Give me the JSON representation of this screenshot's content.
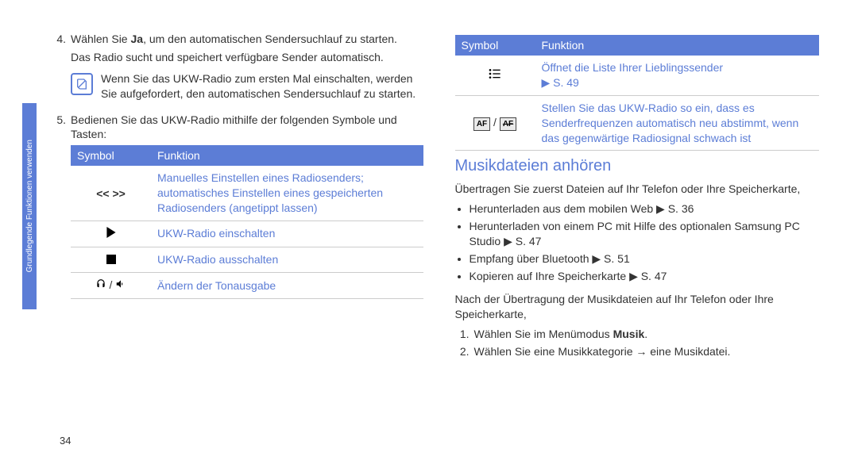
{
  "sidebar_label": "Grundlegende Funktionen verwenden",
  "page_number": "34",
  "left": {
    "step4_num": "4.",
    "step4_a": "Wählen Sie ",
    "step4_bold": "Ja",
    "step4_b": ", um den automatischen Sendersuchlauf zu starten.",
    "step4_sub": "Das Radio sucht und speichert verfügbare Sender automatisch.",
    "note": "Wenn Sie das UKW-Radio zum ersten Mal einschalten, werden Sie aufgefordert, den automatischen Sendersuchlauf zu starten.",
    "step5_num": "5.",
    "step5": "Bedienen Sie das UKW-Radio mithilfe der folgenden Symbole und Tasten:",
    "table": {
      "h1": "Symbol",
      "h2": "Funktion",
      "rows": [
        {
          "sym": "<<  >>",
          "func": "Manuelles Einstellen eines Radiosenders; automatisches Einstellen eines gespeicherten Radiosenders (angetippt lassen)"
        },
        {
          "sym": "play",
          "func": "UKW-Radio einschalten"
        },
        {
          "sym": "stop",
          "func": "UKW-Radio ausschalten"
        },
        {
          "sym": "audio",
          "func": "Ändern der Tonausgabe"
        }
      ]
    }
  },
  "right": {
    "table": {
      "h1": "Symbol",
      "h2": "Funktion",
      "rows": [
        {
          "sym": "list",
          "func": "Öffnet die Liste Ihrer Lieblingssender",
          "ref": "▶ S. 49"
        },
        {
          "sym": "af",
          "func": "Stellen Sie das UKW-Radio so ein, dass es Senderfrequenzen automatisch neu abstimmt, wenn das gegenwärtige Radiosignal schwach ist"
        }
      ]
    },
    "heading": "Musikdateien anhören",
    "intro": "Übertragen Sie zuerst Dateien auf Ihr Telefon oder Ihre Speicherkarte,",
    "bullets": [
      "Herunterladen aus dem mobilen Web ▶ S. 36",
      "Herunterladen von einem PC mit Hilfe des optionalen Samsung PC Studio ▶ S. 47",
      "Empfang über Bluetooth ▶ S. 51",
      "Kopieren auf Ihre Speicherkarte ▶ S. 47"
    ],
    "after": "Nach der Übertragung der Musikdateien auf Ihr Telefon oder Ihre Speicherkarte,",
    "step1_num": "1.",
    "step1_a": "Wählen Sie im Menümodus ",
    "step1_bold": "Musik",
    "step1_b": ".",
    "step2_num": "2.",
    "step2": "Wählen Sie eine Musikkategorie → eine Musikdatei."
  }
}
